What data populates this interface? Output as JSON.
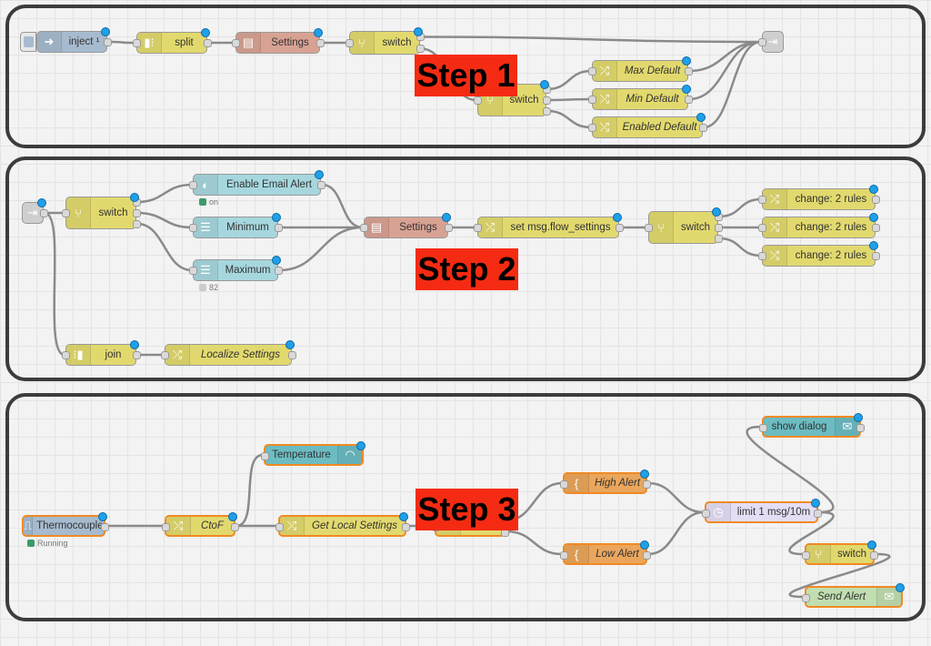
{
  "colors": {
    "inject": "#a6bbcf",
    "function": "#e2d96e",
    "settings": "#d8a293",
    "dashboard_light": "#a6d7de",
    "dashboard": "#6cbcc2",
    "template": "#eaa65c",
    "delay": "#e4def5",
    "email": "#c0deaf",
    "step_label": "#f42b12",
    "changed_dot": "#1fa0e8",
    "selected_border": "#f08a24"
  },
  "step1": {
    "label": "Step 1",
    "nodes": {
      "inject": "inject ¹",
      "split": "split",
      "settings": "Settings",
      "switch1": "switch",
      "switch2": "switch",
      "max_default": "Max Default",
      "min_default": "Min Default",
      "enabled_default": "Enabled Default"
    }
  },
  "step2": {
    "label": "Step 2",
    "nodes": {
      "switch1": "switch",
      "enable_email": "Enable Email Alert",
      "enable_email_status": "on",
      "minimum": "Minimum",
      "maximum": "Maximum",
      "maximum_status": "82",
      "settings": "Settings",
      "set_flow": "set msg.flow_settings",
      "switch2": "switch",
      "change1": "change: 2 rules",
      "change2": "change: 2 rules",
      "change3": "change: 2 rules",
      "join": "join",
      "localize": "Localize Settings"
    }
  },
  "step3": {
    "label": "Step 3",
    "nodes": {
      "thermocouple": "Thermocouple",
      "thermocouple_status": "Running",
      "ctof": "CtoF",
      "temperature": "Temperature",
      "get_local": "Get Local Settings",
      "switch1": "switch",
      "high_alert": "High Alert",
      "low_alert": "Low Alert",
      "limit": "limit 1 msg/10m",
      "show_dialog": "show dialog",
      "switch2": "switch",
      "send_alert": "Send Alert"
    }
  },
  "icons": {
    "inject": "arrow-right-icon",
    "split": "split-icon",
    "settings": "settings-icon",
    "switch": "switch-branch-icon",
    "change": "shuffle-icon",
    "link": "link-icon",
    "toggle": "toggle-icon",
    "slider": "slider-icon",
    "join": "join-icon",
    "template": "brace-icon",
    "delay": "timer-icon",
    "gauge": "gauge-icon",
    "email": "envelope-icon",
    "thermocouple": "square-wave-icon"
  }
}
